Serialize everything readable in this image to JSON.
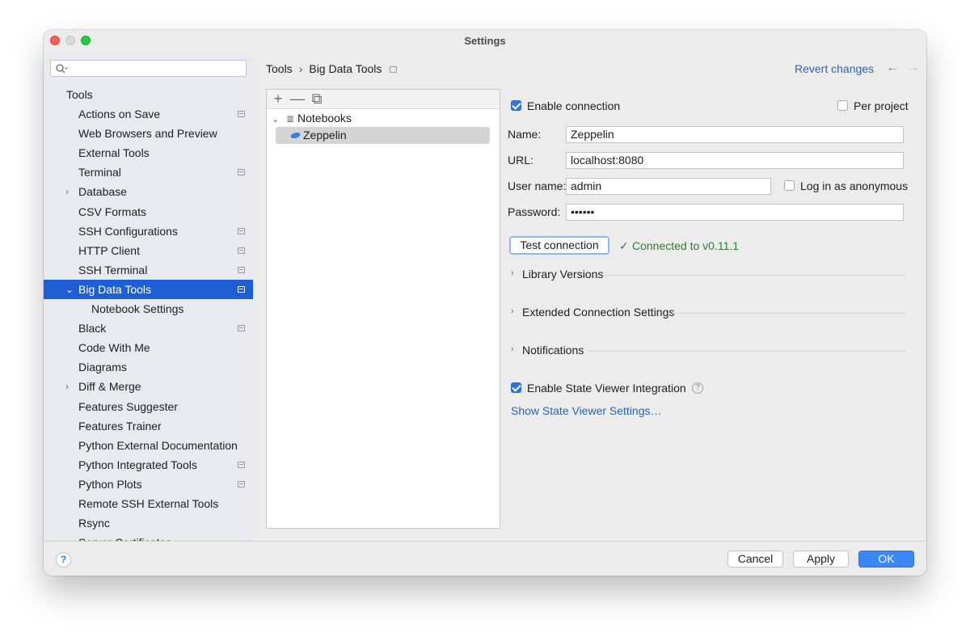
{
  "window": {
    "title": "Settings"
  },
  "search": {
    "placeholder": "",
    "value": ""
  },
  "sidebar": {
    "items": [
      {
        "label": "Tools",
        "level": 0,
        "pinned": false
      },
      {
        "label": "Actions on Save",
        "level": 1,
        "pinned": true
      },
      {
        "label": "Web Browsers and Preview",
        "level": 1,
        "pinned": false
      },
      {
        "label": "External Tools",
        "level": 1,
        "pinned": false
      },
      {
        "label": "Terminal",
        "level": 1,
        "pinned": true
      },
      {
        "label": "Database",
        "level": 1,
        "pinned": false,
        "expandable": true
      },
      {
        "label": "CSV Formats",
        "level": 1,
        "pinned": false
      },
      {
        "label": "SSH Configurations",
        "level": 1,
        "pinned": true
      },
      {
        "label": "HTTP Client",
        "level": 1,
        "pinned": true
      },
      {
        "label": "SSH Terminal",
        "level": 1,
        "pinned": true
      },
      {
        "label": "Big Data Tools",
        "level": 1,
        "pinned": true,
        "expandable": true,
        "expanded": true,
        "selected": true
      },
      {
        "label": "Notebook Settings",
        "level": 2,
        "pinned": false
      },
      {
        "label": "Black",
        "level": 1,
        "pinned": true
      },
      {
        "label": "Code With Me",
        "level": 1,
        "pinned": false
      },
      {
        "label": "Diagrams",
        "level": 1,
        "pinned": false
      },
      {
        "label": "Diff & Merge",
        "level": 1,
        "pinned": false,
        "expandable": true
      },
      {
        "label": "Features Suggester",
        "level": 1,
        "pinned": false
      },
      {
        "label": "Features Trainer",
        "level": 1,
        "pinned": false
      },
      {
        "label": "Python External Documentation",
        "level": 1,
        "pinned": false
      },
      {
        "label": "Python Integrated Tools",
        "level": 1,
        "pinned": true
      },
      {
        "label": "Python Plots",
        "level": 1,
        "pinned": true
      },
      {
        "label": "Remote SSH External Tools",
        "level": 1,
        "pinned": false
      },
      {
        "label": "Rsync",
        "level": 1,
        "pinned": false
      },
      {
        "label": "Server Certificates",
        "level": 1,
        "pinned": false
      }
    ]
  },
  "breadcrumb": {
    "parent": "Tools",
    "separator": "›",
    "current": "Big Data Tools"
  },
  "header": {
    "revert": "Revert changes",
    "back_icon": "←",
    "forward_icon": "→"
  },
  "connections": {
    "toolbar": {
      "add_icon": "+",
      "remove_icon": "—",
      "copy_icon": "⧉"
    },
    "group": "Notebooks",
    "item": "Zeppelin"
  },
  "form": {
    "enable_connection": {
      "label": "Enable connection",
      "checked": true
    },
    "per_project": {
      "label": "Per project",
      "checked": false
    },
    "name": {
      "label": "Name:",
      "value": "Zeppelin"
    },
    "url": {
      "label": "URL:",
      "value": "localhost:8080"
    },
    "username": {
      "label": "User name:",
      "value": "admin"
    },
    "anonymous": {
      "label": "Log in as anonymous",
      "checked": false
    },
    "password": {
      "label": "Password:",
      "value": "••••••"
    },
    "test_button": "Test connection",
    "status": "Connected to v0.11.1",
    "sections": [
      "Library Versions",
      "Extended Connection Settings",
      "Notifications"
    ],
    "state_viewer": {
      "label": "Enable State Viewer Integration",
      "checked": true
    },
    "state_viewer_link": "Show State Viewer Settings…"
  },
  "footer": {
    "help": "?",
    "cancel": "Cancel",
    "apply": "Apply",
    "ok": "OK"
  },
  "colors": {
    "accent": "#1e5fd6",
    "link": "#2c64b5",
    "success": "#2e7d2e",
    "ok_button": "#3a87f5"
  }
}
